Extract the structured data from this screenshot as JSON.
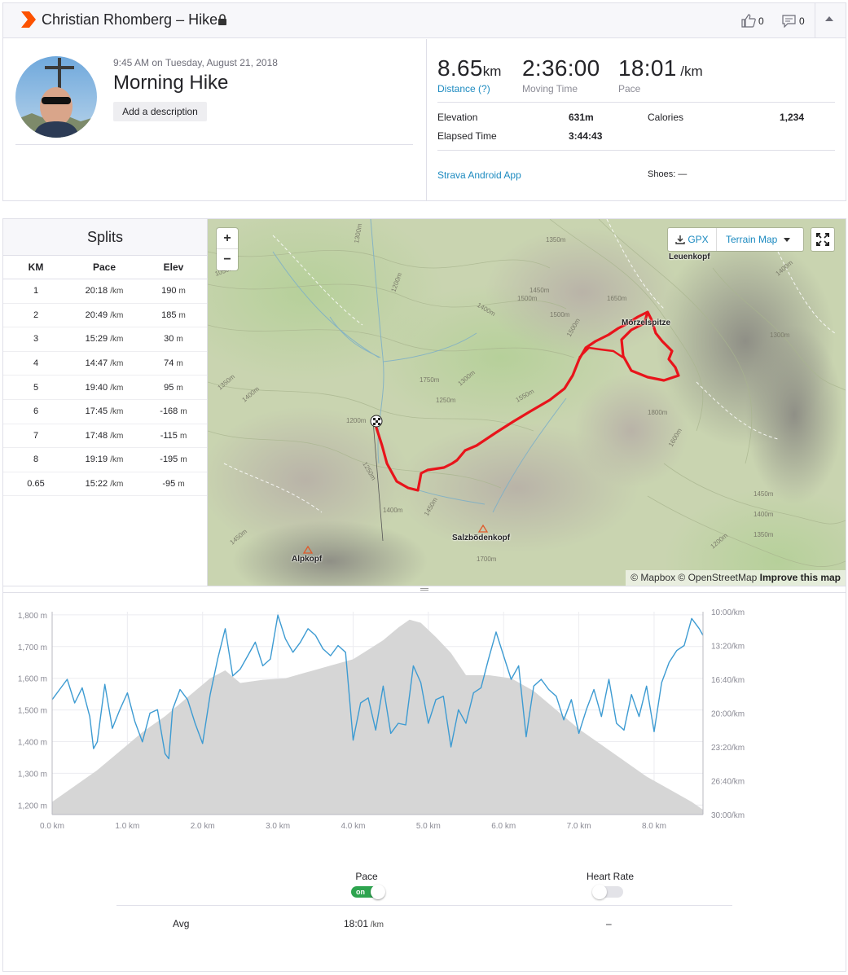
{
  "header": {
    "title": "Christian Rhomberg – Hike",
    "kudos_count": "0",
    "comment_count": "0",
    "brand_color": "#fc5200"
  },
  "activity": {
    "date": "9:45 AM on Tuesday, August 21, 2018",
    "name": "Morning Hike",
    "add_description": "Add a description"
  },
  "stats": {
    "distance": {
      "value": "8.65",
      "unit": "km",
      "label": "Distance (?)"
    },
    "moving_time": {
      "value": "2:36:00",
      "label": "Moving Time"
    },
    "pace": {
      "value": "18:01",
      "unit": " /km",
      "label": "Pace"
    },
    "elevation": {
      "label": "Elevation",
      "value": "631m"
    },
    "calories": {
      "label": "Calories",
      "value": "1,234"
    },
    "elapsed": {
      "label": "Elapsed Time",
      "value": "3:44:43"
    },
    "device": "Strava Android App",
    "shoes": "Shoes: —"
  },
  "splits": {
    "title": "Splits",
    "headers": [
      "KM",
      "Pace",
      "Elev"
    ],
    "pace_unit": "/km",
    "elev_unit": "m",
    "rows": [
      {
        "km": "1",
        "pace": "20:18",
        "elev": "190"
      },
      {
        "km": "2",
        "pace": "20:49",
        "elev": "185"
      },
      {
        "km": "3",
        "pace": "15:29",
        "elev": "30"
      },
      {
        "km": "4",
        "pace": "14:47",
        "elev": "74"
      },
      {
        "km": "5",
        "pace": "19:40",
        "elev": "95"
      },
      {
        "km": "6",
        "pace": "17:45",
        "elev": "-168"
      },
      {
        "km": "7",
        "pace": "17:48",
        "elev": "-115"
      },
      {
        "km": "8",
        "pace": "19:19",
        "elev": "-195"
      },
      {
        "km": "0.65",
        "pace": "15:22",
        "elev": "-95"
      }
    ]
  },
  "map": {
    "zoom_in": "+",
    "zoom_out": "−",
    "gpx": "GPX",
    "map_type": "Terrain Map",
    "labels": [
      "Leuenkopf",
      "Mörzelspitze",
      "Salzbödenkopf",
      "Alpkopf"
    ],
    "attribution_1": "© Mapbox © OpenStreetMap",
    "attribution_2": "Improve this map",
    "route_color": "#e8141b"
  },
  "chart_data": {
    "type": "area",
    "x_label_ticks": [
      "0.0 km",
      "1.0 km",
      "2.0 km",
      "3.0 km",
      "4.0 km",
      "5.0 km",
      "6.0 km",
      "7.0 km",
      "8.0 km"
    ],
    "y_left_ticks": [
      "1,800 m",
      "1,700 m",
      "1,600 m",
      "1,500 m",
      "1,400 m",
      "1,300 m",
      "1,200 m"
    ],
    "y_right_ticks": [
      "10:00/km",
      "13:20/km",
      "16:40/km",
      "20:00/km",
      "23:20/km",
      "26:40/km",
      "30:00/km"
    ],
    "xlim": [
      0,
      8.65
    ],
    "ylim_left": [
      1170,
      1810
    ],
    "ylim_right_seconds": [
      600,
      1800
    ],
    "series": [
      {
        "type": "area",
        "color": "#d6d6d6",
        "x": [
          0,
          0.3,
          0.6,
          0.9,
          1.2,
          1.5,
          1.8,
          2.1,
          2.3,
          2.5,
          2.8,
          3.1,
          3.4,
          3.7,
          4.0,
          4.2,
          4.4,
          4.6,
          4.75,
          4.9,
          5.1,
          5.3,
          5.5,
          5.8,
          6.1,
          6.4,
          6.7,
          7.0,
          7.3,
          7.6,
          7.9,
          8.2,
          8.5,
          8.65
        ],
        "y": [
          1210,
          1260,
          1310,
          1370,
          1430,
          1480,
          1540,
          1600,
          1625,
          1585,
          1595,
          1600,
          1620,
          1640,
          1660,
          1690,
          1720,
          1760,
          1785,
          1775,
          1730,
          1680,
          1610,
          1610,
          1600,
          1560,
          1500,
          1440,
          1390,
          1340,
          1290,
          1250,
          1210,
          1185
        ]
      },
      {
        "type": "line",
        "color": "#3d9bd2",
        "x": [
          0,
          0.1,
          0.2,
          0.3,
          0.4,
          0.5,
          0.55,
          0.6,
          0.7,
          0.8,
          0.9,
          1.0,
          1.1,
          1.2,
          1.3,
          1.4,
          1.5,
          1.55,
          1.6,
          1.7,
          1.8,
          1.9,
          2.0,
          2.1,
          2.2,
          2.3,
          2.4,
          2.5,
          2.6,
          2.7,
          2.8,
          2.9,
          3.0,
          3.1,
          3.2,
          3.3,
          3.4,
          3.5,
          3.6,
          3.7,
          3.8,
          3.9,
          4.0,
          4.1,
          4.2,
          4.3,
          4.4,
          4.5,
          4.6,
          4.7,
          4.8,
          4.9,
          5.0,
          5.1,
          5.2,
          5.3,
          5.4,
          5.5,
          5.6,
          5.7,
          5.8,
          5.9,
          6.0,
          6.1,
          6.2,
          6.3,
          6.4,
          6.5,
          6.6,
          6.7,
          6.8,
          6.9,
          7.0,
          7.1,
          7.2,
          7.3,
          7.4,
          7.5,
          7.6,
          7.7,
          7.8,
          7.9,
          8.0,
          8.1,
          8.2,
          8.3,
          8.4,
          8.5,
          8.6,
          8.65
        ],
        "y_seconds": [
          1120,
          1060,
          1000,
          1140,
          1050,
          1220,
          1410,
          1370,
          1030,
          1290,
          1180,
          1080,
          1250,
          1370,
          1200,
          1180,
          1440,
          1470,
          1180,
          1060,
          1120,
          1260,
          1380,
          1090,
          880,
          700,
          980,
          940,
          860,
          780,
          920,
          880,
          620,
          760,
          840,
          780,
          700,
          740,
          820,
          860,
          800,
          840,
          1360,
          1140,
          1110,
          1300,
          1040,
          1320,
          1260,
          1270,
          920,
          1020,
          1260,
          1120,
          1100,
          1400,
          1180,
          1260,
          1080,
          1050,
          880,
          720,
          860,
          1000,
          920,
          1340,
          1040,
          1000,
          1060,
          1100,
          1240,
          1120,
          1320,
          1180,
          1060,
          1220,
          1000,
          1260,
          1300,
          1090,
          1220,
          1040,
          1310,
          1020,
          900,
          830,
          800,
          640,
          700,
          740
        ]
      }
    ]
  },
  "toggles": {
    "pace_label": "Pace",
    "pace_state": "on",
    "hr_label": "Heart Rate",
    "avg_label": "Avg",
    "avg_pace": "18:01",
    "avg_pace_unit": " /km",
    "avg_hr": "–"
  }
}
